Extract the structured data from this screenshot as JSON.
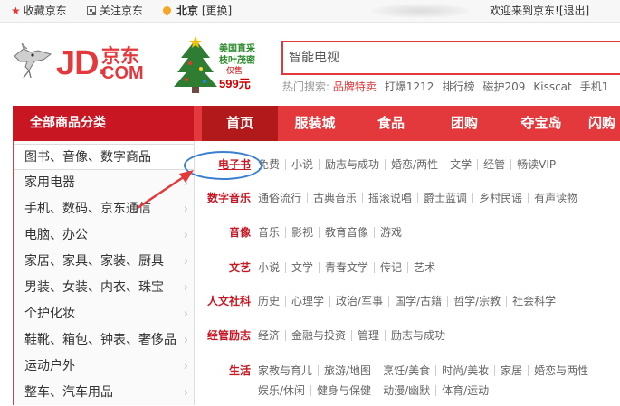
{
  "topbar": {
    "favorite": "收藏京东",
    "follow": "关注京东",
    "city": "北京",
    "change": "[更换]",
    "welcome": "欢迎来到京东!",
    "logout": "[退出]"
  },
  "logo": {
    "jd": "JD.",
    "cn": "京东",
    "com": "COM"
  },
  "promo": {
    "line1": "美国直采",
    "line2": "枝叶茂密",
    "line3": "仅售",
    "price": "599元"
  },
  "search": {
    "placeholder": "智能电视"
  },
  "hot": {
    "label": "热门搜索:",
    "keywords": [
      "品牌特卖",
      "打爆1212",
      "排行榜",
      "磁护209",
      "Kisscat",
      "手机1"
    ]
  },
  "nav": {
    "all_categories": "全部商品分类",
    "tabs": [
      "首页",
      "服装城",
      "食品",
      "团购",
      "夺宝岛",
      "闪购"
    ]
  },
  "categories": [
    "图书、音像、数字商品",
    "家用电器",
    "手机、数码、京东通信",
    "电脑、办公",
    "家居、家具、家装、厨具",
    "男装、女装、内衣、珠宝",
    "个护化妆",
    "鞋靴、箱包、钟表、奢侈品",
    "运动户外",
    "整车、汽车用品"
  ],
  "arrow": "›",
  "subcategories": [
    {
      "label": "电子书",
      "items": [
        "免费",
        "小说",
        "励志与成功",
        "婚恋/两性",
        "文学",
        "经管",
        "畅读VIP"
      ]
    },
    {
      "label": "数字音乐",
      "items": [
        "通俗流行",
        "古典音乐",
        "摇滚说唱",
        "爵士蓝调",
        "乡村民谣",
        "有声读物"
      ]
    },
    {
      "label": "音像",
      "items": [
        "音乐",
        "影视",
        "教育音像",
        "游戏"
      ]
    },
    {
      "label": "文艺",
      "items": [
        "小说",
        "文学",
        "青春文学",
        "传记",
        "艺术"
      ]
    },
    {
      "label": "人文社科",
      "items": [
        "历史",
        "心理学",
        "政治/军事",
        "国学/古籍",
        "哲学/宗教",
        "社会科学"
      ]
    },
    {
      "label": "经管励志",
      "items": [
        "经济",
        "金融与投资",
        "管理",
        "励志与成功"
      ]
    },
    {
      "label": "生活",
      "items": [
        "家教与育儿",
        "旅游/地图",
        "烹饪/美食",
        "时尚/美妆",
        "家居",
        "婚恋与两性"
      ]
    },
    {
      "label": "",
      "items": [
        "娱乐/休闲",
        "健身与保健",
        "动漫/幽默",
        "体育/运动"
      ]
    }
  ]
}
